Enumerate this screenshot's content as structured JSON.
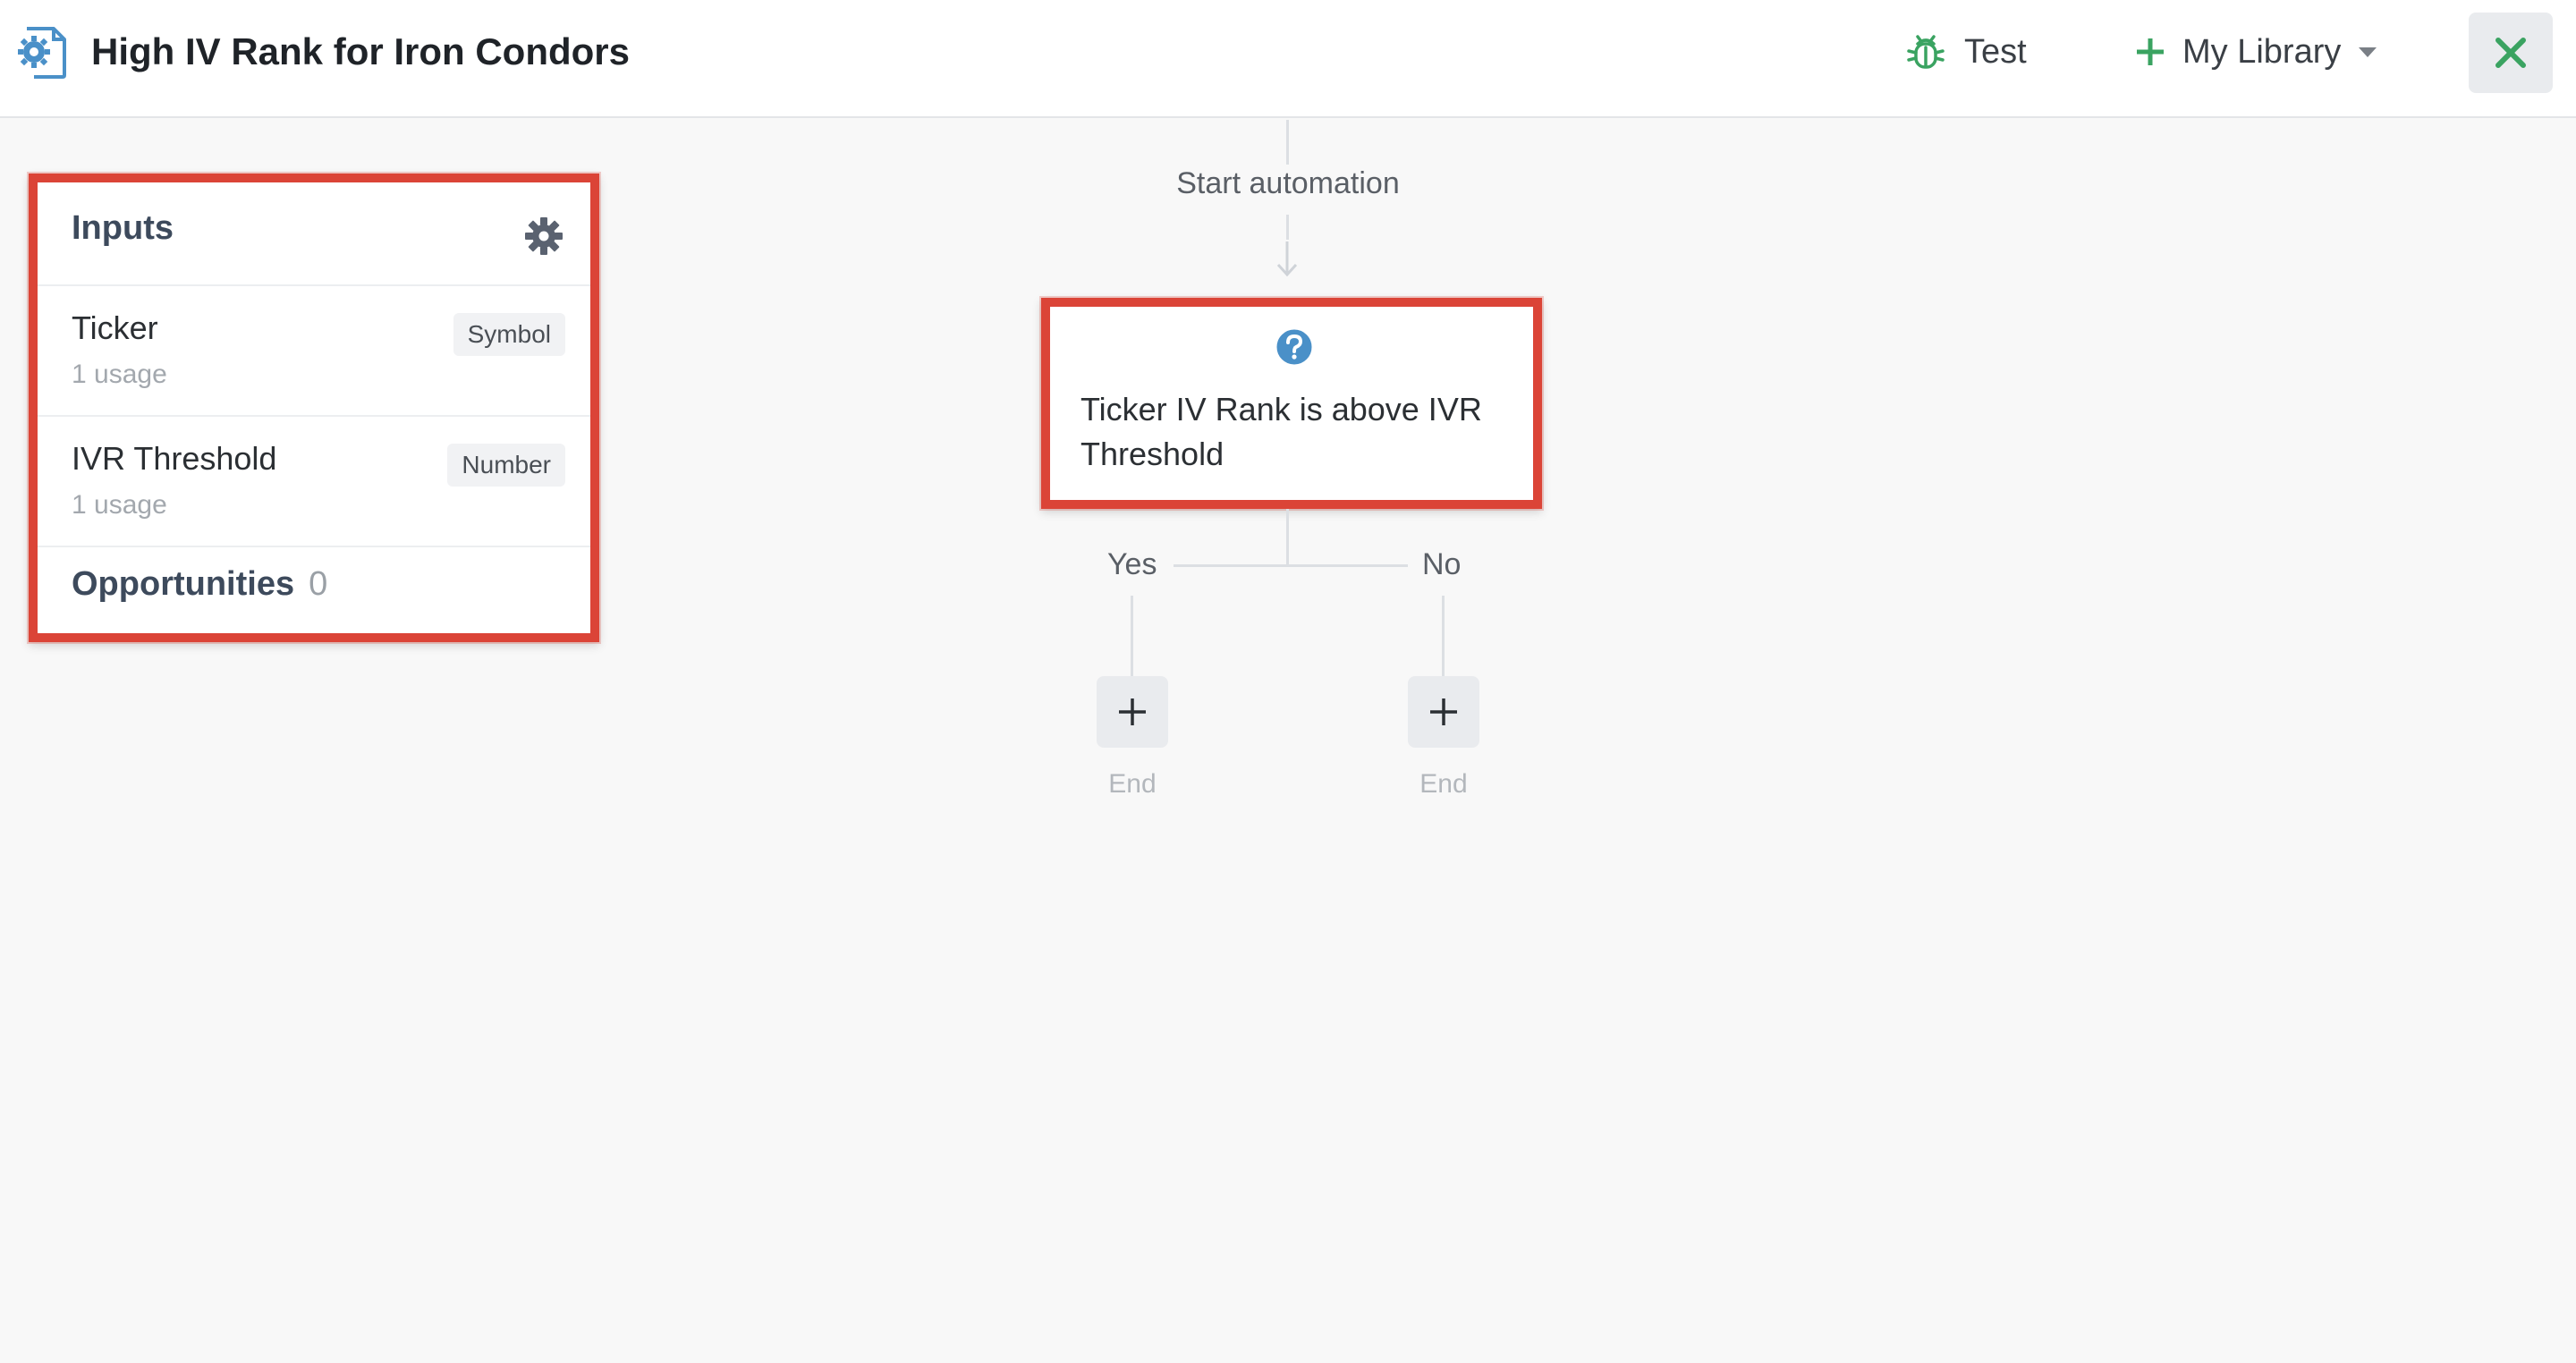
{
  "header": {
    "title": "High IV Rank for Iron Condors",
    "app_icon": "gear-document-icon",
    "test_label": "Test",
    "test_icon": "bug-icon",
    "library_label": "My Library",
    "library_icon": "plus-icon",
    "library_caret_icon": "caret-down-icon",
    "close_icon": "close-icon"
  },
  "inputs_panel": {
    "title": "Inputs",
    "settings_icon": "gear-icon",
    "items": [
      {
        "name": "Ticker",
        "usage": "1 usage",
        "type": "Symbol"
      },
      {
        "name": "IVR Threshold",
        "usage": "1 usage",
        "type": "Number"
      }
    ],
    "opportunities_label": "Opportunities",
    "opportunities_count": "0"
  },
  "flow": {
    "start_label": "Start automation",
    "condition": {
      "icon": "question-icon",
      "text": "Ticker IV Rank is above IVR Threshold"
    },
    "branches": [
      {
        "label": "Yes",
        "end_label": "End"
      },
      {
        "label": "No",
        "end_label": "End"
      }
    ]
  },
  "colors": {
    "highlight": "#db4437",
    "accent_green": "#3aa361",
    "help_blue": "#4a90c8"
  }
}
